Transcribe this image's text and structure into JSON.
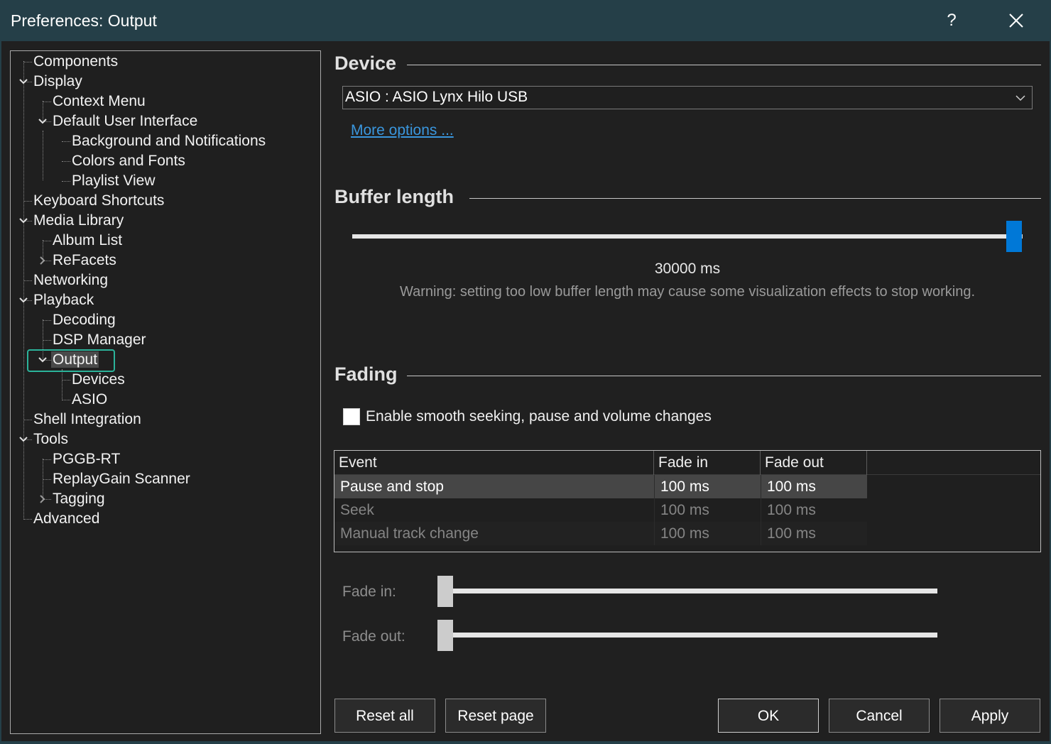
{
  "window": {
    "title": "Preferences: Output",
    "help_label": "?",
    "colors": {
      "titlebar": "#253f48",
      "accent": "#0078d7",
      "selection_frame": "#2bb39a",
      "link": "#3a96dd"
    }
  },
  "tree": {
    "items": [
      {
        "label": "Components",
        "expander": "none"
      },
      {
        "label": "Display",
        "expander": "expanded"
      },
      {
        "label": "Context Menu",
        "expander": "none"
      },
      {
        "label": "Default User Interface",
        "expander": "expanded"
      },
      {
        "label": "Background and Notifications",
        "expander": "none"
      },
      {
        "label": "Colors and Fonts",
        "expander": "none"
      },
      {
        "label": "Playlist View",
        "expander": "none"
      },
      {
        "label": "Keyboard Shortcuts",
        "expander": "none"
      },
      {
        "label": "Media Library",
        "expander": "expanded"
      },
      {
        "label": "Album List",
        "expander": "none"
      },
      {
        "label": "ReFacets",
        "expander": "collapsed"
      },
      {
        "label": "Networking",
        "expander": "none"
      },
      {
        "label": "Playback",
        "expander": "expanded"
      },
      {
        "label": "Decoding",
        "expander": "none"
      },
      {
        "label": "DSP Manager",
        "expander": "none"
      },
      {
        "label": "Output",
        "expander": "expanded",
        "selected": true
      },
      {
        "label": "Devices",
        "expander": "none"
      },
      {
        "label": "ASIO",
        "expander": "none"
      },
      {
        "label": "Shell Integration",
        "expander": "none"
      },
      {
        "label": "Tools",
        "expander": "expanded"
      },
      {
        "label": "PGGB-RT",
        "expander": "none"
      },
      {
        "label": "ReplayGain Scanner",
        "expander": "none"
      },
      {
        "label": "Tagging",
        "expander": "collapsed"
      },
      {
        "label": "Advanced",
        "expander": "none"
      }
    ]
  },
  "device": {
    "header": "Device",
    "selected": "ASIO : ASIO Lynx Hilo USB",
    "more_options": "More options ..."
  },
  "buffer": {
    "header": "Buffer length",
    "value_label": "30000 ms",
    "slider_fraction": 1.0,
    "warning": "Warning: setting too low buffer length may cause some visualization effects to stop working."
  },
  "fading": {
    "header": "Fading",
    "checkbox_label": "Enable smooth seeking, pause and volume changes",
    "checked": false,
    "columns": [
      "Event",
      "Fade in",
      "Fade out"
    ],
    "rows": [
      {
        "event": "Pause and stop",
        "fade_in": "100 ms",
        "fade_out": "100 ms",
        "selected": true
      },
      {
        "event": "Seek",
        "fade_in": "100 ms",
        "fade_out": "100 ms",
        "selected": false
      },
      {
        "event": "Manual track change",
        "fade_in": "100 ms",
        "fade_out": "100 ms",
        "selected": false
      }
    ],
    "fade_in_label": "Fade in:",
    "fade_out_label": "Fade out:",
    "fade_in_fraction": 0.0,
    "fade_out_fraction": 0.0
  },
  "buttons": {
    "reset_all": "Reset all",
    "reset_page": "Reset page",
    "ok": "OK",
    "cancel": "Cancel",
    "apply": "Apply"
  }
}
